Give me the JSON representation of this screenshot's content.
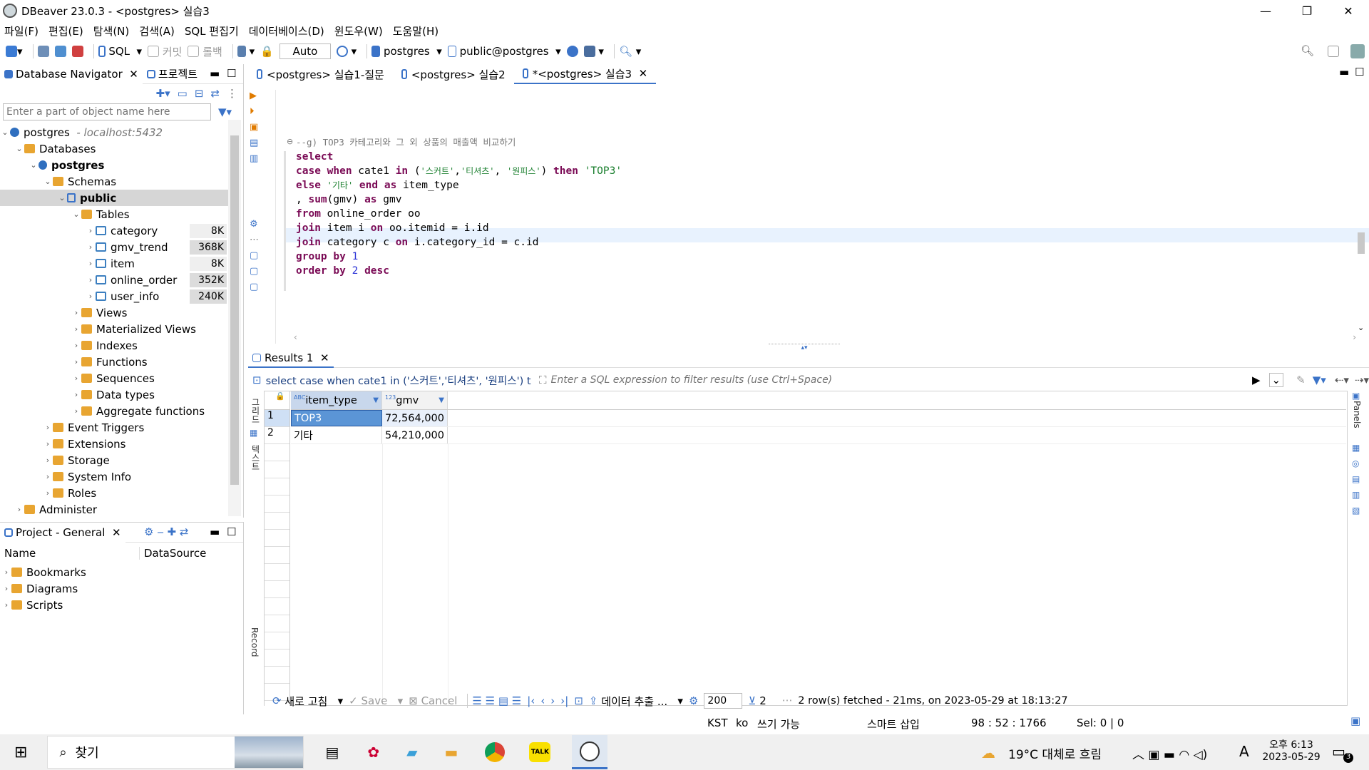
{
  "window": {
    "title": "DBeaver 23.0.3 - <postgres> 실습3"
  },
  "menu": [
    "파일(F)",
    "편집(E)",
    "탐색(N)",
    "검색(A)",
    "SQL 편집기",
    "데이터베이스(D)",
    "윈도우(W)",
    "도움말(H)"
  ],
  "toolbar": {
    "sql": "SQL",
    "commit": "커밋",
    "rollback": "롤백",
    "auto": "Auto",
    "datasource": "postgres",
    "schema": "public@postgres"
  },
  "navigator": {
    "tab1": "Database Navigator",
    "tab2": "프로젝트",
    "filter_placeholder": "Enter a part of object name here",
    "conn": "postgres",
    "conn_host": "- localhost:5432",
    "databases": "Databases",
    "db": "postgres",
    "schemas": "Schemas",
    "public": "public",
    "tables": "Tables",
    "table_rows": [
      {
        "name": "category",
        "size": "8K"
      },
      {
        "name": "gmv_trend",
        "size": "368K"
      },
      {
        "name": "item",
        "size": "8K"
      },
      {
        "name": "online_order",
        "size": "352K"
      },
      {
        "name": "user_info",
        "size": "240K"
      }
    ],
    "folders": [
      "Views",
      "Materialized Views",
      "Indexes",
      "Functions",
      "Sequences",
      "Data types",
      "Aggregate functions"
    ],
    "db_folders": [
      "Event Triggers",
      "Extensions",
      "Storage",
      "System Info",
      "Roles"
    ],
    "administer": "Administer"
  },
  "project": {
    "tab": "Project - General",
    "col_name": "Name",
    "col_ds": "DataSource",
    "items": [
      "Bookmarks",
      "Diagrams",
      "Scripts"
    ]
  },
  "editor": {
    "tabs": [
      "<postgres> 실습1-질문",
      "<postgres> 실습2",
      "*<postgres> 실습3"
    ],
    "comment": "--g) TOP3 카테고리와 그 외 상품의 매출액 비교하기"
  },
  "results": {
    "tab": "Results 1",
    "query_preview": "select case when cate1 in ('스커트','티셔츠', '원피스') t",
    "filter_placeholder": "Enter a SQL expression to filter results (use Ctrl+Space)",
    "side_grid": "그리드",
    "side_text": "텍스트",
    "side_record": "Record",
    "panels": "Panels",
    "columns": [
      {
        "type": "ABC",
        "name": "item_type"
      },
      {
        "type": "123",
        "name": "gmv"
      }
    ],
    "rows": [
      {
        "n": "1",
        "item_type": "TOP3",
        "gmv": "72,564,000"
      },
      {
        "n": "2",
        "item_type": "기타",
        "gmv": "54,210,000"
      }
    ],
    "refresh": "새로 고침",
    "save": "Save",
    "cancel": "Cancel",
    "export": "데이터 추출 ...",
    "fetch_size": "200",
    "fetch_count": "2",
    "fetch_status": "2 row(s) fetched - 21ms, on 2023-05-29 at 18:13:27"
  },
  "status": {
    "tz": "KST",
    "lang": "ko",
    "mode": "쓰기 가능",
    "insert": "스마트 삽입",
    "pos": "98 : 52 : 1766",
    "sel": "Sel: 0 | 0"
  },
  "taskbar": {
    "search": "찾기",
    "weather": "19°C 대체로 흐림",
    "ime": "A",
    "time": "오후 6:13",
    "date": "2023-05-29",
    "badge": "3"
  }
}
